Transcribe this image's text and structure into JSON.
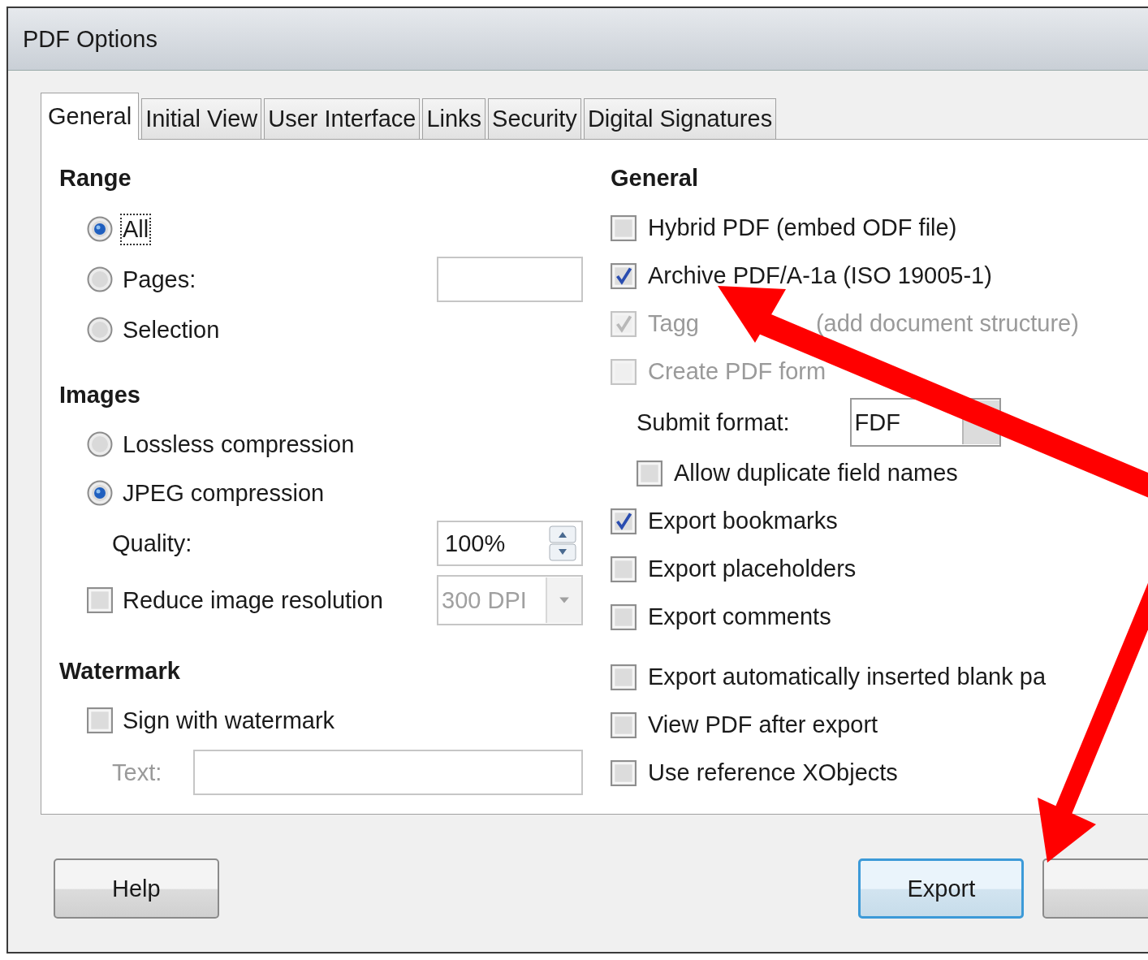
{
  "window": {
    "title": "PDF Options"
  },
  "tabs": [
    {
      "label": "General",
      "selected": true
    },
    {
      "label": "Initial View",
      "selected": false
    },
    {
      "label": "User Interface",
      "selected": false
    },
    {
      "label": "Links",
      "selected": false
    },
    {
      "label": "Security",
      "selected": false
    },
    {
      "label": "Digital Signatures",
      "selected": false
    }
  ],
  "range": {
    "heading": "Range",
    "options": [
      {
        "label": "All",
        "selected": true,
        "focused": true
      },
      {
        "label": "Pages:",
        "selected": false,
        "focused": false
      },
      {
        "label": "Selection",
        "selected": false,
        "focused": false
      }
    ]
  },
  "images": {
    "heading": "Images",
    "options": [
      {
        "label": "Lossless compression",
        "selected": false
      },
      {
        "label": "JPEG compression",
        "selected": true
      }
    ],
    "quality": {
      "label": "Quality:",
      "value": "100%"
    },
    "reduce": {
      "label": "Reduce image resolution",
      "checked": false,
      "value": "300 DPI",
      "disabled": true
    }
  },
  "watermark": {
    "heading": "Watermark",
    "sign": {
      "label": "Sign with watermark",
      "checked": false
    },
    "text": {
      "label": "Text:",
      "disabled": true
    }
  },
  "general": {
    "heading": "General",
    "sections": [
      {
        "items": [
          {
            "kind": "checkbox",
            "label": "Hybrid PDF (embed ODF file)",
            "checked": false,
            "disabled": false
          },
          {
            "kind": "checkbox",
            "label": "Archive PDF/A-1a (ISO 19005-1)",
            "checked": true,
            "disabled": false
          },
          {
            "kind": "checkbox",
            "label": "Tagg",
            "label_after": "(add document structure)",
            "checked": true,
            "disabled": true
          },
          {
            "kind": "checkbox",
            "label": "Create PDF form",
            "checked": false,
            "disabled": true,
            "children": [
              {
                "kind": "combo",
                "label": "Submit format:",
                "value": "FDF"
              },
              {
                "kind": "checkbox",
                "label": "Allow duplicate field names",
                "checked": false,
                "disabled": false
              }
            ]
          },
          {
            "kind": "checkbox",
            "label": "Export bookmarks",
            "checked": true,
            "disabled": false
          },
          {
            "kind": "checkbox",
            "label": "Export placeholders",
            "checked": false,
            "disabled": false
          },
          {
            "kind": "checkbox",
            "label": "Export comments",
            "checked": false,
            "disabled": false
          }
        ]
      },
      {
        "items": [
          {
            "kind": "checkbox",
            "label": "Export automatically inserted blank pa",
            "checked": false,
            "disabled": false
          },
          {
            "kind": "checkbox",
            "label": "View PDF after export",
            "checked": false,
            "disabled": false
          },
          {
            "kind": "checkbox",
            "label": "Use reference XObjects",
            "checked": false,
            "disabled": false
          }
        ]
      }
    ]
  },
  "buttons": [
    {
      "label": "Help",
      "default": false
    },
    {
      "label": "Export",
      "default": true
    }
  ]
}
